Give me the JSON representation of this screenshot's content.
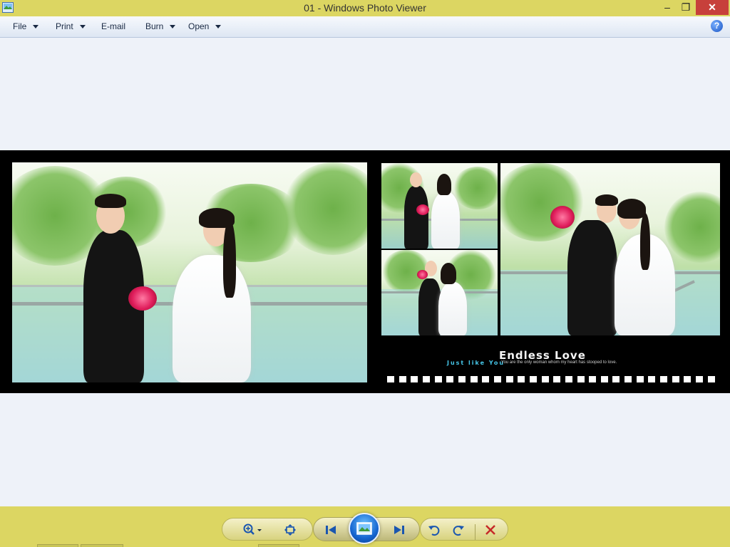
{
  "window": {
    "title": "01 - Windows Photo Viewer",
    "icon": "photo-viewer-icon",
    "controls": {
      "minimize": "–",
      "maximize": "❐",
      "close": "✕"
    },
    "titlebar_color": "#dcd662",
    "close_color": "#c7403b"
  },
  "menu": {
    "items": [
      {
        "label": "File",
        "dropdown": true
      },
      {
        "label": "Print",
        "dropdown": true
      },
      {
        "label": "E-mail",
        "dropdown": false
      },
      {
        "label": "Burn",
        "dropdown": true
      },
      {
        "label": "Open",
        "dropdown": true
      }
    ],
    "help": "?"
  },
  "photo": {
    "title_text": "Endless Love",
    "script_text": "Just like",
    "script_sub": "You",
    "tagline": "You are the only woman whom my heart has stooped to love."
  },
  "toolbar": {
    "icons": {
      "zoom": "zoom-icon",
      "fit": "actual-size-icon",
      "previous": "previous-icon",
      "slideshow": "slideshow-icon",
      "next": "next-icon",
      "rotate_left": "rotate-counterclockwise-icon",
      "rotate_right": "rotate-clockwise-icon",
      "delete": "delete-icon"
    },
    "toolbar_color": "#dcd662",
    "delete_color": "#c62828"
  }
}
